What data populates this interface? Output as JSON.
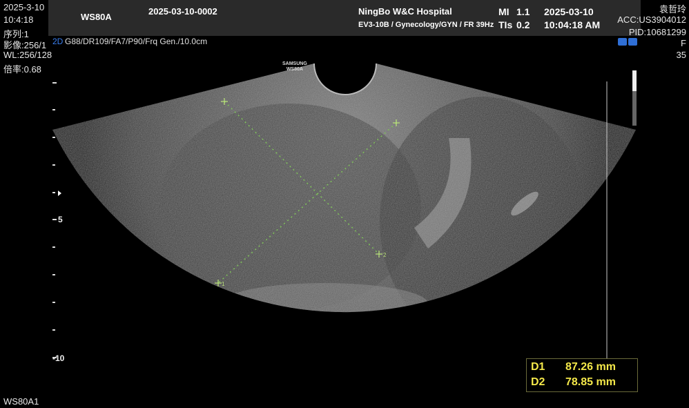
{
  "left_info": {
    "date": "2025-3-10",
    "time": "10:4:18",
    "series": "序列:1",
    "image": "影像:256/1",
    "wl": "WL:256/128",
    "zoom": "倍率:0.68"
  },
  "header": {
    "model": "WS80A",
    "study_id": "2025-03-10-0002",
    "hospital": "NingBo W&C Hospital",
    "probe_info": "EV3-10B / Gynecology/GYN / FR 39Hz",
    "mi_label": "MI",
    "mi_value": "1.1",
    "tis_label": "TIs",
    "tis_value": "0.2",
    "date": "2025-03-10",
    "time": "10:04:18 AM"
  },
  "patient": {
    "name": "袁哲玲",
    "acc": "ACC:US3904012",
    "pid": "PID:10681299",
    "sex": "F",
    "age": "35"
  },
  "params": {
    "mode": "2D",
    "settings": "G88/DR109/FA7/P90/Frq Gen./10.0cm"
  },
  "probe_logo": {
    "line1": "SAMSUNG",
    "line2": "WS80A"
  },
  "depth_scale": {
    "label_5": "5",
    "label_10": "-10"
  },
  "calipers": {
    "d1_marker": "2",
    "d2_marker": "1"
  },
  "measurements": [
    {
      "label": "D1",
      "value": "87.26 mm"
    },
    {
      "label": "D2",
      "value": "78.85 mm"
    }
  ],
  "footer": {
    "device": "WS80A1"
  },
  "colors": {
    "measurement_text": "#f4e84a",
    "caliper_line": "#7fc25a",
    "header_bg": "#2a2a2a",
    "mode_icon": "#2f6fd6"
  }
}
